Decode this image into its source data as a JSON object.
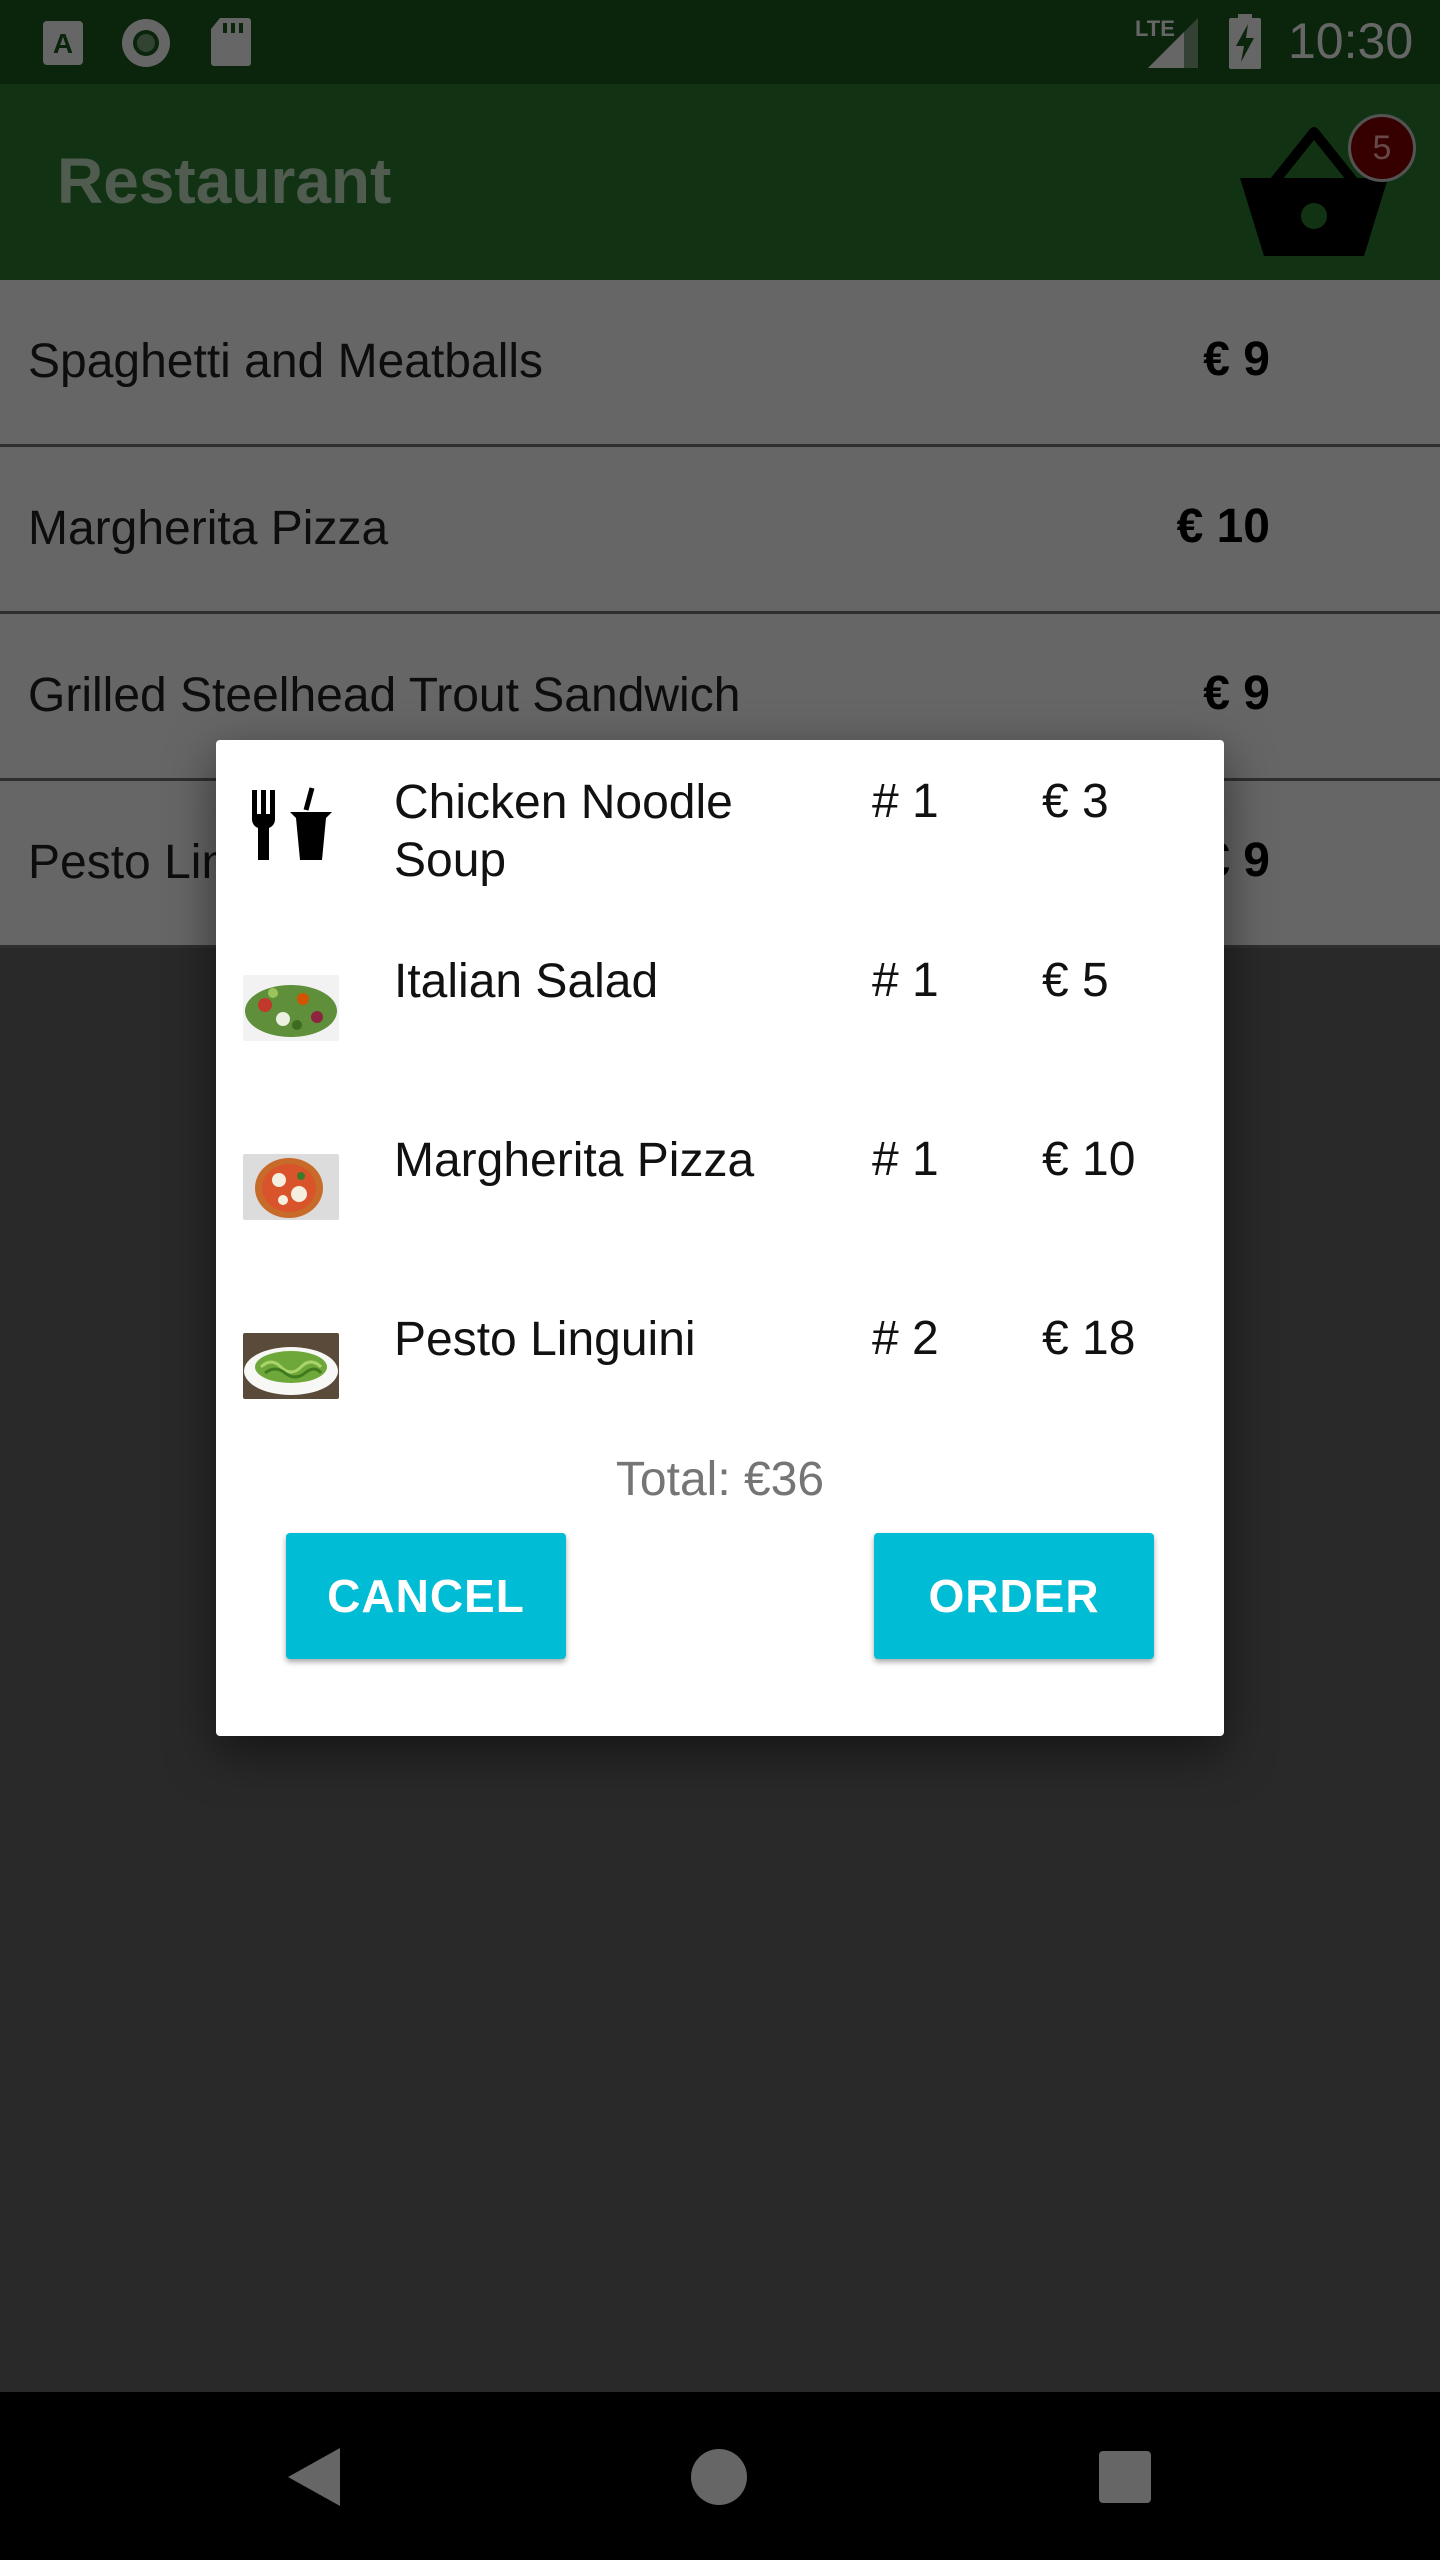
{
  "status_bar": {
    "time": "10:30",
    "network": "LTE"
  },
  "app_bar": {
    "title": "Restaurant",
    "cart_count": "5"
  },
  "menu": [
    {
      "name": "Spaghetti and Meatballs",
      "price": "€ 9"
    },
    {
      "name": "Margherita Pizza",
      "price": "€ 10"
    },
    {
      "name": "Grilled Steelhead Trout Sandwich",
      "price": "€ 9"
    },
    {
      "name": "Pesto Linguini",
      "price": "€ 9"
    }
  ],
  "dialog": {
    "items": [
      {
        "name": "Chicken Noodle Soup",
        "qty": "# 1",
        "price": "€ 3",
        "icon": "restaurant-icon"
      },
      {
        "name": "Italian Salad",
        "qty": "# 1",
        "price": "€ 5",
        "icon": "salad-photo"
      },
      {
        "name": "Margherita Pizza",
        "qty": "# 1",
        "price": "€ 10",
        "icon": "pizza-photo"
      },
      {
        "name": "Pesto Linguini",
        "qty": "# 2",
        "price": "€ 18",
        "icon": "pasta-photo"
      }
    ],
    "total": "Total: €36",
    "cancel_label": "CANCEL",
    "order_label": "ORDER"
  },
  "colors": {
    "primary": "#2e7d32",
    "primary_dark": "#1b5e20",
    "accent": "#00bcd4",
    "badge": "#8b0000"
  }
}
